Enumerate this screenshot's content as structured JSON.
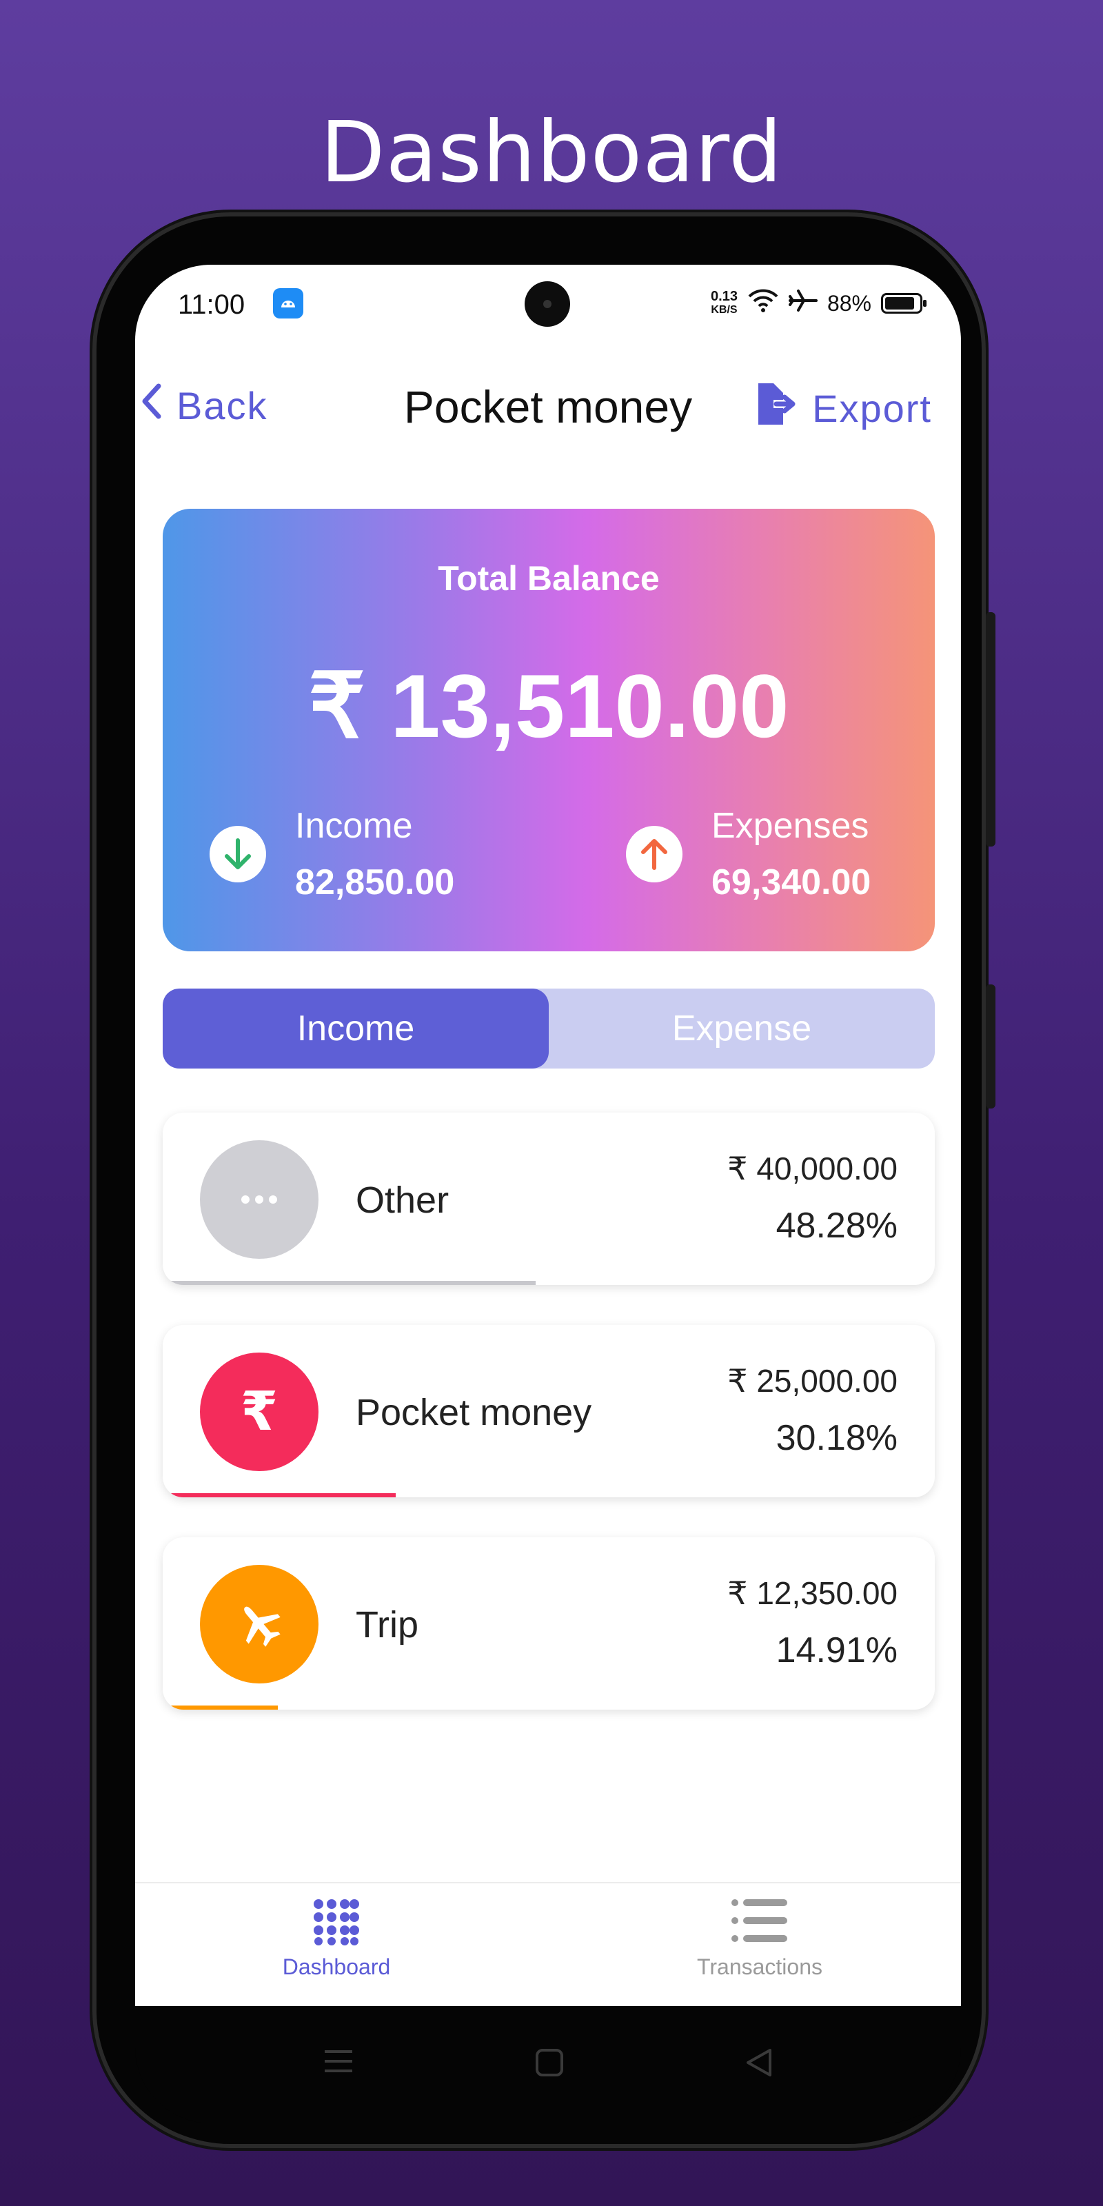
{
  "promo": {
    "title": "Dashboard"
  },
  "status_bar": {
    "time": "11:00",
    "net_speed_top": "0.13",
    "net_speed_bottom": "KB/S",
    "battery": "88%",
    "battery_level": 0.88
  },
  "header": {
    "back_label": "Back",
    "title": "Pocket money",
    "export_label": "Export"
  },
  "balance": {
    "label": "Total Balance",
    "amount": "₹ 13,510.00",
    "income_label": "Income",
    "income_value": "82,850.00",
    "expenses_label": "Expenses",
    "expenses_value": "69,340.00"
  },
  "tabs": [
    {
      "label": "Income",
      "active": true
    },
    {
      "label": "Expense",
      "active": false
    }
  ],
  "categories": [
    {
      "name": "Other",
      "amount": "₹ 40,000.00",
      "percent": "48.28%",
      "share": 0.4828,
      "icon": "more-icon",
      "color": "#cfcfd4",
      "bar_color": "#c7c7cc"
    },
    {
      "name": "Pocket money",
      "amount": "₹ 25,000.00",
      "percent": "30.18%",
      "share": 0.3018,
      "icon": "rupee-icon",
      "color": "#f42c5b",
      "bar_color": "#f42c5b"
    },
    {
      "name": "Trip",
      "amount": "₹ 12,350.00",
      "percent": "14.91%",
      "share": 0.1491,
      "icon": "airplane-icon",
      "color": "#ff9800",
      "bar_color": "#ff9800"
    }
  ],
  "bottom_nav": [
    {
      "label": "Dashboard",
      "icon": "grid-dots-icon",
      "active": true,
      "color": "#5b5bd6"
    },
    {
      "label": "Transactions",
      "icon": "list-icon",
      "active": false,
      "color": "#9a9a9a"
    }
  ],
  "colors": {
    "accent": "#5b5bd6",
    "income_arrow": "#2fb36b",
    "expense_arrow": "#f2673f"
  }
}
